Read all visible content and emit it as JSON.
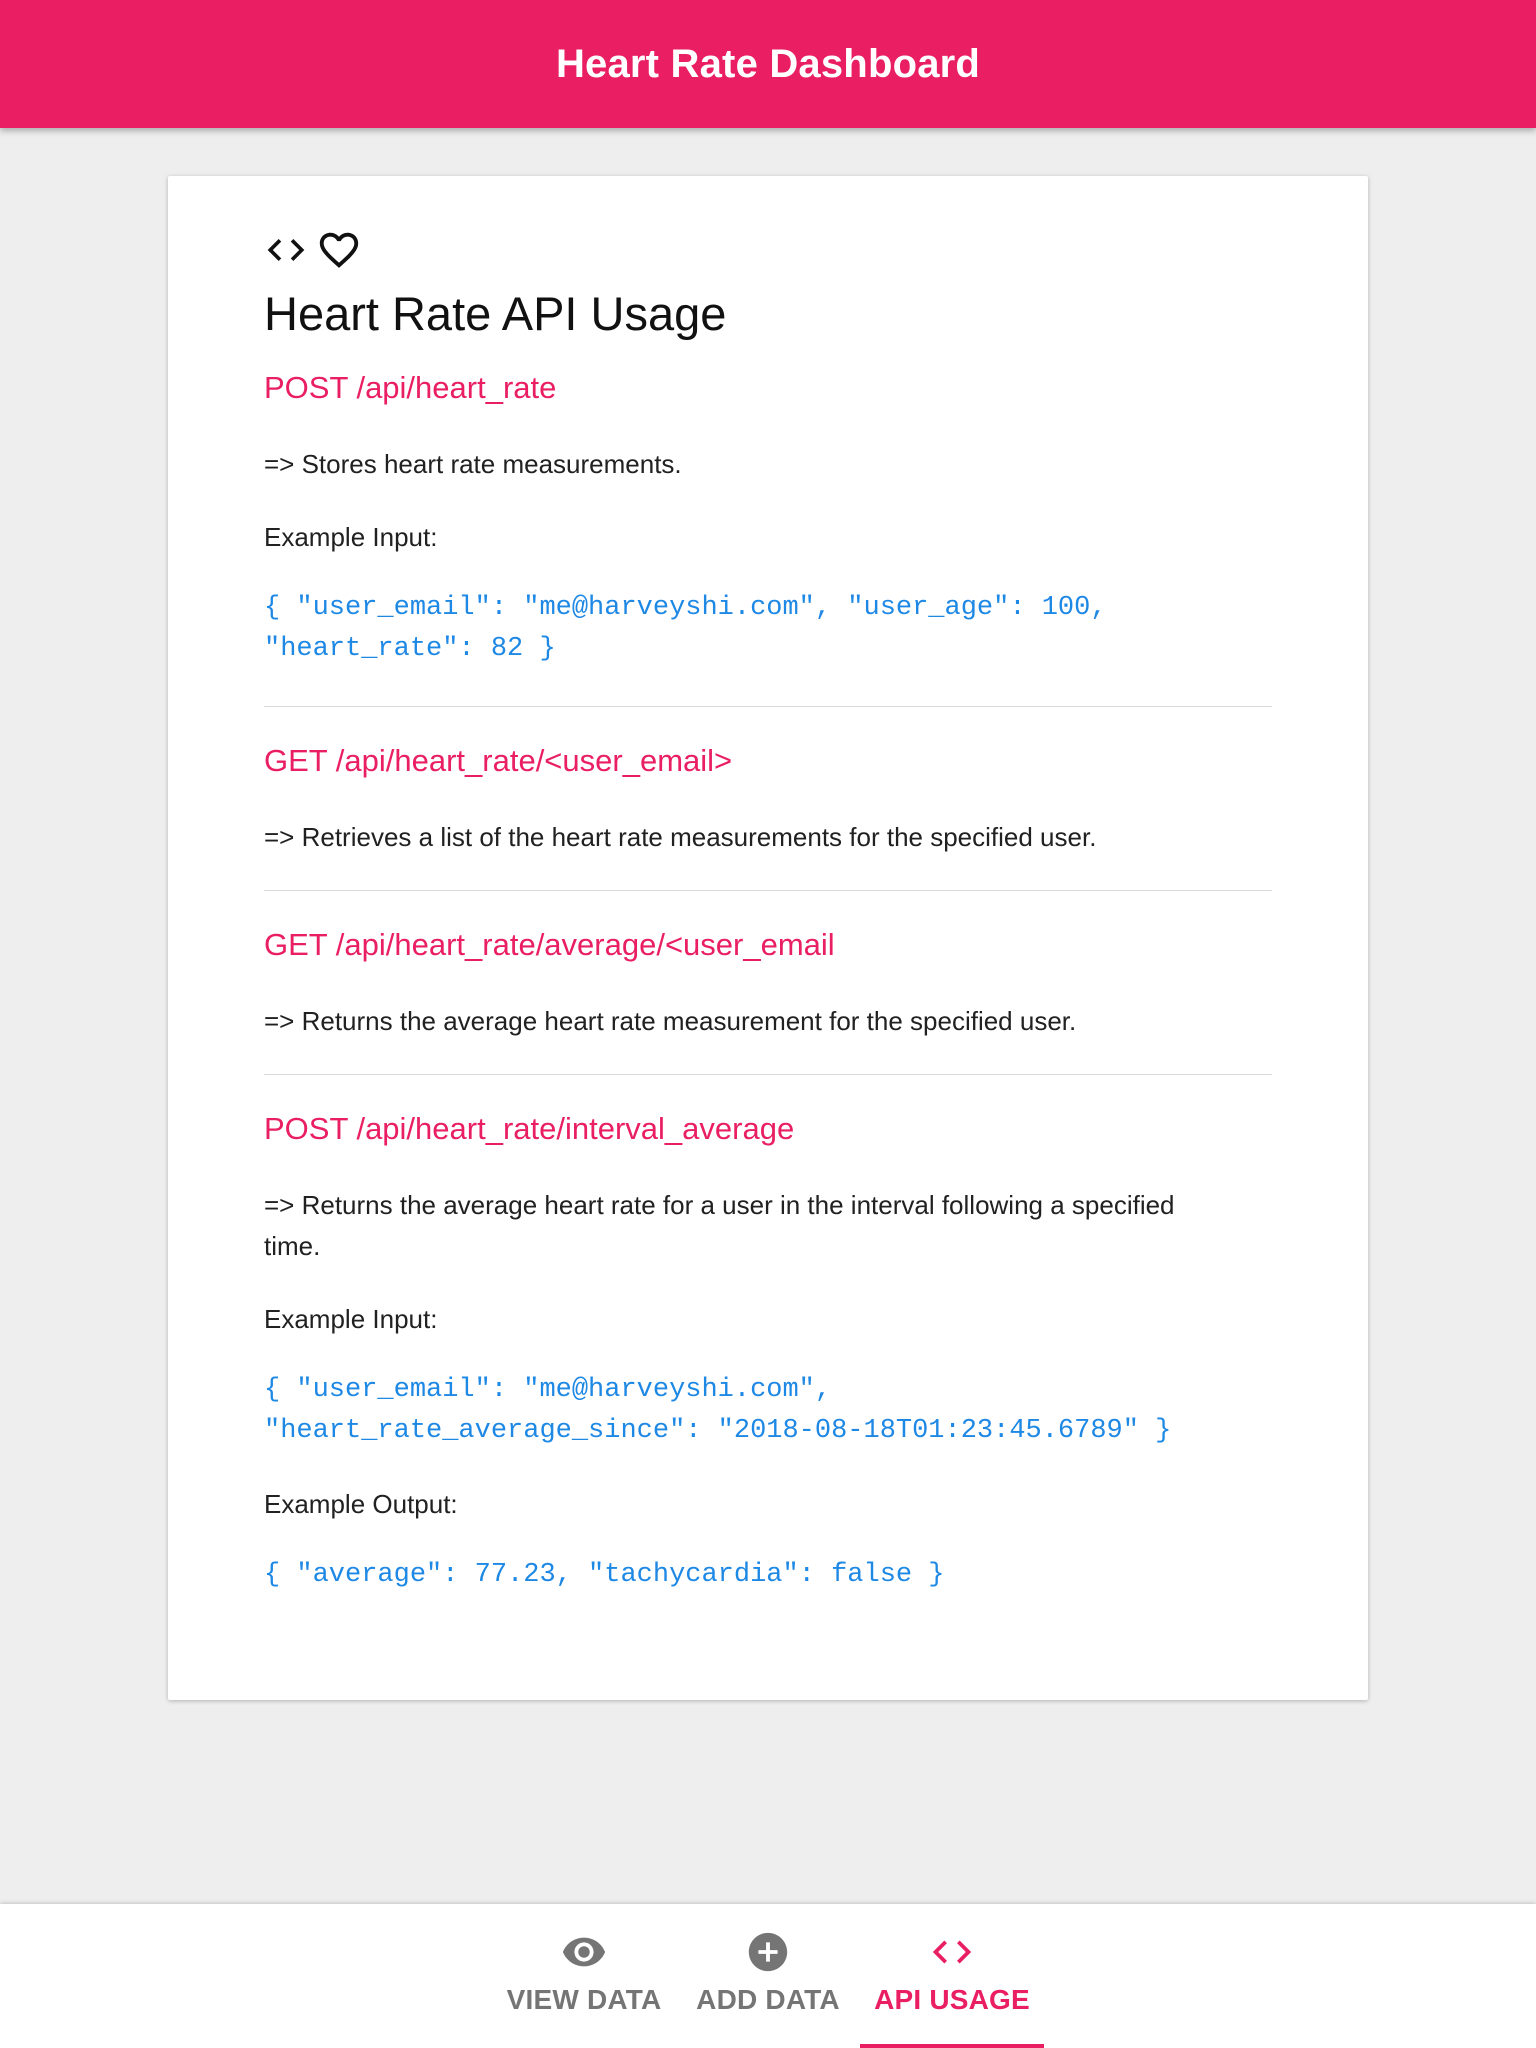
{
  "appbar": {
    "title": "Heart Rate Dashboard"
  },
  "card": {
    "icons": [
      "code-icon",
      "heart-outline-icon"
    ],
    "title": "Heart Rate API Usage",
    "endpoints": [
      {
        "title": "POST /api/heart_rate",
        "description": "=> Stores heart rate measurements.",
        "input_label": "Example Input:",
        "input_line1": "{ \"user_email\": \"me@harveyshi.com\", \"user_age\": 100,",
        "input_line2": "\"heart_rate\": 82 }"
      },
      {
        "title": "GET /api/heart_rate/<user_email>",
        "description": "=> Retrieves a list of the heart rate measurements for the specified user."
      },
      {
        "title": "GET /api/heart_rate/average/<user_email",
        "description": "=> Returns the average heart rate measurement for the specified user."
      },
      {
        "title": "POST /api/heart_rate/interval_average",
        "description_line1": "=> Returns the average heart rate for a user in the interval following a specified",
        "description_line2": "time.",
        "input_label": "Example Input:",
        "input_line1": "{ \"user_email\": \"me@harveyshi.com\",",
        "input_line2": "\"heart_rate_average_since\": \"2018-08-18T01:23:45.6789\" }",
        "output_label": "Example Output:",
        "output_line1": "{ \"average\": 77.23, \"tachycardia\": false }"
      }
    ]
  },
  "bottom_nav": {
    "items": [
      {
        "label": "VIEW DATA",
        "icon": "eye-icon",
        "active": false
      },
      {
        "label": "ADD DATA",
        "icon": "add-circle-icon",
        "active": false
      },
      {
        "label": "API USAGE",
        "icon": "code-icon",
        "active": true
      }
    ]
  },
  "colors": {
    "primary": "#e91e63",
    "code": "#1e88e5",
    "background": "#eeeeee",
    "inactive_nav": "#757575"
  }
}
